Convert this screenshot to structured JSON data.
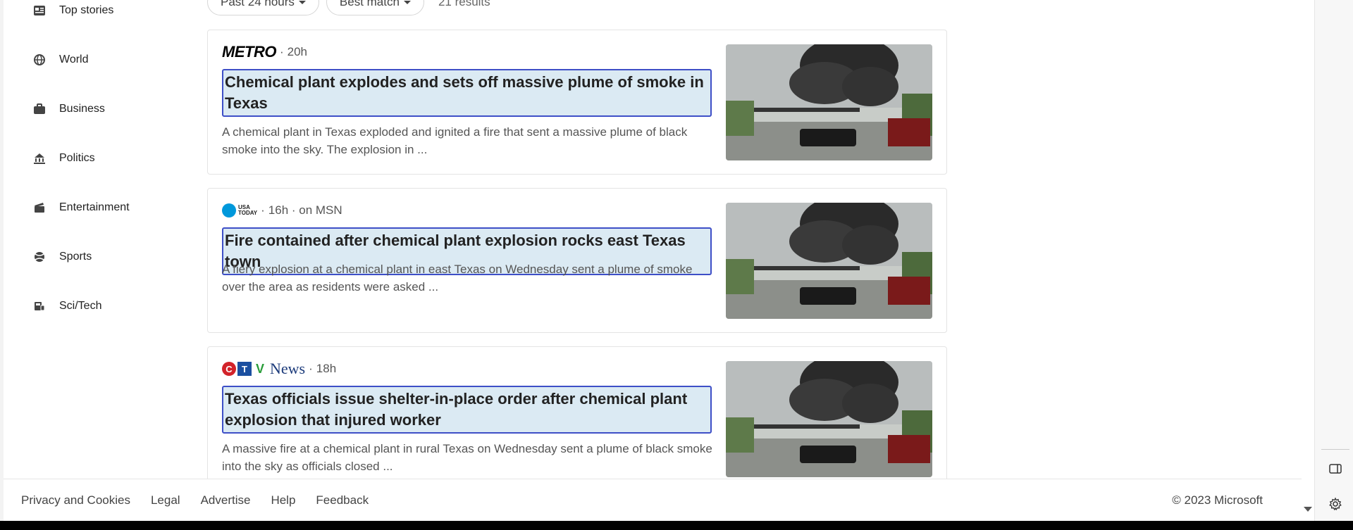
{
  "sidebar": {
    "items": [
      {
        "label": "Top stories",
        "icon": "top-stories-icon"
      },
      {
        "label": "World",
        "icon": "globe-icon"
      },
      {
        "label": "Business",
        "icon": "briefcase-icon"
      },
      {
        "label": "Politics",
        "icon": "capitol-icon"
      },
      {
        "label": "Entertainment",
        "icon": "clapperboard-icon"
      },
      {
        "label": "Sports",
        "icon": "sports-ball-icon"
      },
      {
        "label": "Sci/Tech",
        "icon": "scitech-icon"
      }
    ]
  },
  "filters": {
    "time": "Past 24 hours",
    "sort": "Best match",
    "results_count": "21 results"
  },
  "articles": [
    {
      "source": "METRO",
      "meta": "20h",
      "title": "Chemical plant explodes and sets off massive plume of smoke in Texas",
      "snippet": "A chemical plant in Texas exploded and ignited a fire that sent a massive plume of black smoke into the sky. The explosion in ..."
    },
    {
      "source": "USA TODAY",
      "meta": "16h · on MSN",
      "title": "Fire contained after chemical plant explosion rocks east Texas town",
      "snippet": "A fiery explosion at a chemical plant in east Texas on Wednesday sent a plume of smoke over the area as residents were asked ..."
    },
    {
      "source": "CTV News",
      "meta": "18h",
      "title": "Texas officials issue shelter-in-place order after chemical plant explosion that injured worker",
      "snippet": "A massive fire at a chemical plant in rural Texas on Wednesday sent a plume of black smoke into the sky as officials closed ..."
    }
  ],
  "footer": {
    "links": [
      "Privacy and Cookies",
      "Legal",
      "Advertise",
      "Help",
      "Feedback"
    ],
    "copyright": "© 2023 Microsoft"
  },
  "logos": {
    "usa_today_line1": "USA",
    "usa_today_line2": "TODAY",
    "ctv_c": "C",
    "ctv_t": "T",
    "ctv_v": "V",
    "ctv_news": "News"
  },
  "colors": {
    "title_highlight_bg": "#dbeaf3",
    "title_highlight_border": "#3e4fc7"
  }
}
